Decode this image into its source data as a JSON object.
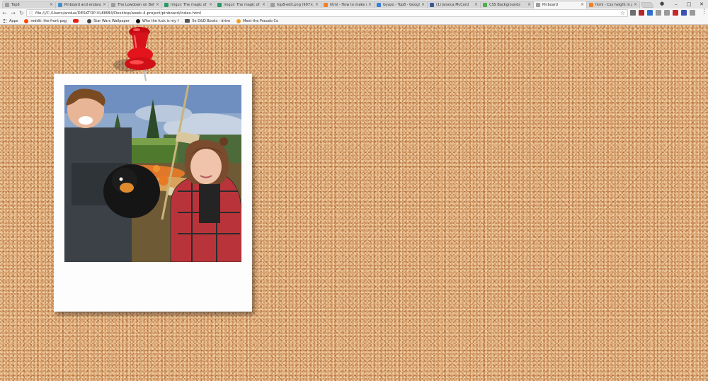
{
  "browser": {
    "tabs": [
      {
        "title": "Top8",
        "icon_color": "#9e9e9e",
        "active": false
      },
      {
        "title": "Pinboard and endangere",
        "icon_color": "#4a90c8",
        "active": false
      },
      {
        "title": "The Lowdown on Befor",
        "icon_color": "#9e9e9e",
        "active": false
      },
      {
        "title": "Imgur: The magic of the",
        "icon_color": "#2b9a66",
        "active": false
      },
      {
        "title": "Imgur: The magic of the",
        "icon_color": "#2b9a66",
        "active": false
      },
      {
        "title": "top8-edit.png (907×383)",
        "icon_color": "#9e9e9e",
        "active": false
      },
      {
        "title": "html - How to make div",
        "icon_color": "#f48024",
        "active": false
      },
      {
        "title": "Gyazo - Top8 - Google",
        "icon_color": "#3b82d6",
        "active": false
      },
      {
        "title": "(1) Jessica McCord",
        "icon_color": "#3b5998",
        "active": false
      },
      {
        "title": "CSS Backgrounds",
        "icon_color": "#4caf50",
        "active": false
      },
      {
        "title": "Pinboard",
        "icon_color": "#9e9e9e",
        "active": true
      },
      {
        "title": "html - Css height in perc",
        "icon_color": "#f48024",
        "active": false
      }
    ],
    "url": "file:///C:/Users/andux/DESKTOP-VL8I8B4/Desktop/week-4-project/pinboard/index.html",
    "bookmarks": [
      {
        "label": "Apps",
        "icon": "apps-grid-icon"
      },
      {
        "label": "reddit: the front pag",
        "icon": "reddit-icon",
        "color": "#ff4500"
      },
      {
        "label": "",
        "icon": "youtube-icon",
        "color": "#e62117"
      },
      {
        "label": "Star Wars Wallpaper",
        "icon": "star-wars-icon",
        "color": "#444444"
      },
      {
        "label": "Who the fuck is my f",
        "icon": "bookmark-dot-icon",
        "color": "#111111"
      },
      {
        "label": "5e D&D Books - drive",
        "icon": "folder-icon",
        "color": "#555555"
      },
      {
        "label": "Meet the Pseudo Co",
        "icon": "sparkle-icon",
        "color": "#f0a020"
      }
    ],
    "window_controls": {
      "minimize": "–",
      "maximize": "□",
      "close": "✕"
    }
  },
  "page": {
    "background": "corkboard",
    "pin_color": "#e3141b",
    "photo_alt": "Selfie at a pumpkin patch"
  }
}
